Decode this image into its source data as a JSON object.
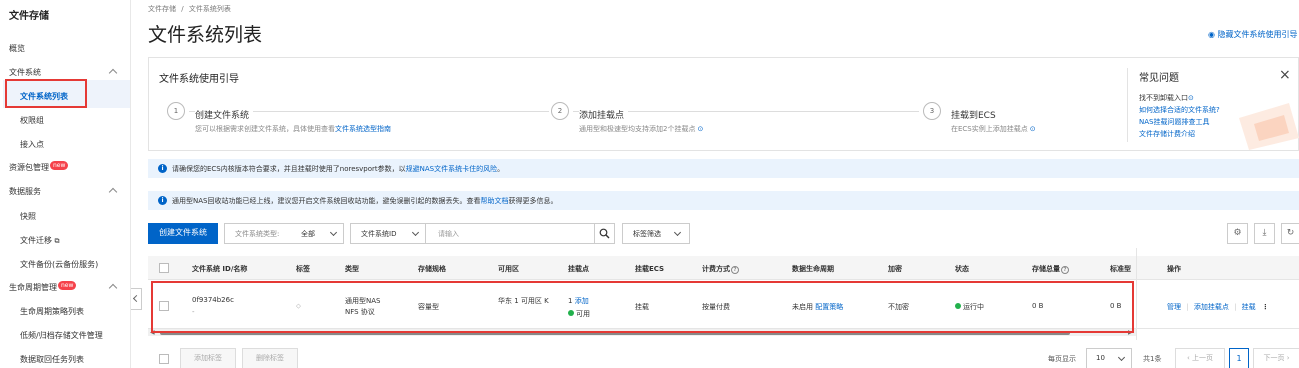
{
  "sidebar": {
    "title": "文件存储",
    "overview": "概览",
    "file_system": "文件系统",
    "file_system_list": "文件系统列表",
    "permission_group": "权限组",
    "access_point": "接入点",
    "resource_package": "资源包管理",
    "new_badge": "new",
    "data_service": "数据服务",
    "snapshot": "快照",
    "file_migration": "文件迁移",
    "file_backup": "文件备份(云备份服务)",
    "lifecycle": "生命周期管理",
    "lifecycle_policy": "生命周期策略列表",
    "low_freq": "低频/归档存储文件管理",
    "data_retrieval": "数据取回任务列表"
  },
  "header": {
    "breadcrumb_root": "文件存储",
    "breadcrumb_sep": "/",
    "breadcrumb_current": "文件系统列表",
    "title": "文件系统列表",
    "hide_guide": "隐藏文件系统使用引导"
  },
  "guide": {
    "title": "文件系统使用引导",
    "steps": [
      {
        "num": "1",
        "title": "创建文件系统",
        "desc": "您可以根据需求创建文件系统，具体使用查看",
        "link": "文件系统选型指南"
      },
      {
        "num": "2",
        "title": "添加挂载点",
        "desc": "通用型和极速型均支持添加2个挂载点",
        "link": ""
      },
      {
        "num": "3",
        "title": "挂载到ECS",
        "desc": "在ECS实例上添加挂载点",
        "link": ""
      }
    ],
    "faq_title": "常见问题",
    "faq": [
      "找不到卸载入口",
      "如何选择合适的文件系统?",
      "NAS挂载问题排查工具",
      "文件存储计费介绍"
    ]
  },
  "notices": [
    {
      "text": "请确保您的ECS内核版本符合要求，并且挂载时使用了noresvport参数，以",
      "link": "规避NAS文件系统卡住的风险",
      "tail": "。"
    },
    {
      "text": "通用型NAS回收站功能已经上线，建议您开启文件系统回收站功能，避免误删引起的数据丢失。查看",
      "link": "帮助文档",
      "tail": "获得更多信息。"
    }
  ],
  "toolbar": {
    "create_button": "创建文件系统",
    "type_label": "文件系统类型:",
    "type_value": "全部",
    "id_filter": "文件系统ID",
    "search_placeholder": "请输入",
    "tag_filter": "标签筛选"
  },
  "table": {
    "headers": [
      "文件系统 ID/名称",
      "标签",
      "类型",
      "存储规格",
      "可用区",
      "挂载点",
      "挂载ECS",
      "计费方式",
      "数据生命周期",
      "加密",
      "状态",
      "存储总量",
      "标准型",
      "操作"
    ],
    "rows": [
      {
        "id": "0f9374b26c",
        "name": "-",
        "type": "通用型NAS NFS 协议",
        "spec": "容量型",
        "zone": "华东 1 可用区 K",
        "mount_count": "1",
        "mount_add": "添加",
        "mount_status": "可用",
        "mount_ecs": "挂载",
        "billing": "按量付费",
        "lifecycle_status": "未启用",
        "lifecycle_link": "配置策略",
        "encryption": "不加密",
        "status": "运行中",
        "storage_total": "0 B",
        "standard": "0 B",
        "action_manage": "管理",
        "action_add_mount": "添加挂载点",
        "action_mount": "挂载",
        "action_more": "⋮"
      }
    ]
  },
  "footer": {
    "add_tag": "添加标签",
    "remove_tag": "删除标签",
    "per_page_label": "每页显示",
    "per_page_value": "10",
    "total": "共1条",
    "prev": "上一页",
    "page": "1",
    "next": "下一页"
  },
  "colors": {
    "accent": "#0064c8",
    "highlight_box": "#e53935",
    "status_green": "#22b14c",
    "badge_red": "#f5424b"
  }
}
